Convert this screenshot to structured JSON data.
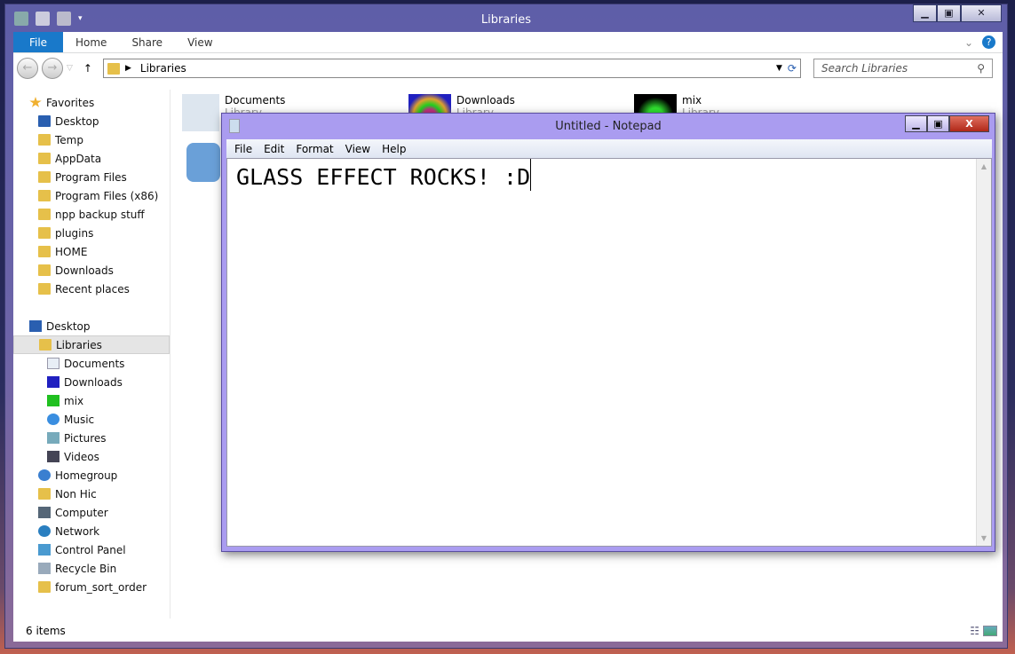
{
  "explorer": {
    "title": "Libraries",
    "ribbon_tabs": [
      "File",
      "Home",
      "Share",
      "View"
    ],
    "address": "Libraries",
    "search_placeholder": "Search Libraries",
    "status": "6 items",
    "nav": {
      "favorites_label": "Favorites",
      "favorites": [
        "Desktop",
        "Temp",
        "AppData",
        "Program Files",
        "Program Files (x86)",
        "npp backup stuff",
        "plugins",
        "HOME",
        "Downloads",
        "Recent places"
      ],
      "desktop_label": "Desktop",
      "libraries_label": "Libraries",
      "libraries": [
        "Documents",
        "Downloads",
        "mix",
        "Music",
        "Pictures",
        "Videos"
      ],
      "others": [
        "Homegroup",
        "Non Hic",
        "Computer",
        "Network",
        "Control Panel",
        "Recycle Bin",
        "forum_sort_order"
      ]
    },
    "items": [
      {
        "name": "Documents",
        "type": "Library"
      },
      {
        "name": "Downloads",
        "type": "Library"
      },
      {
        "name": "mix",
        "type": "Library"
      }
    ]
  },
  "notepad": {
    "title": "Untitled - Notepad",
    "menu": [
      "File",
      "Edit",
      "Format",
      "View",
      "Help"
    ],
    "content": "GLASS EFFECT ROCKS! :D"
  }
}
